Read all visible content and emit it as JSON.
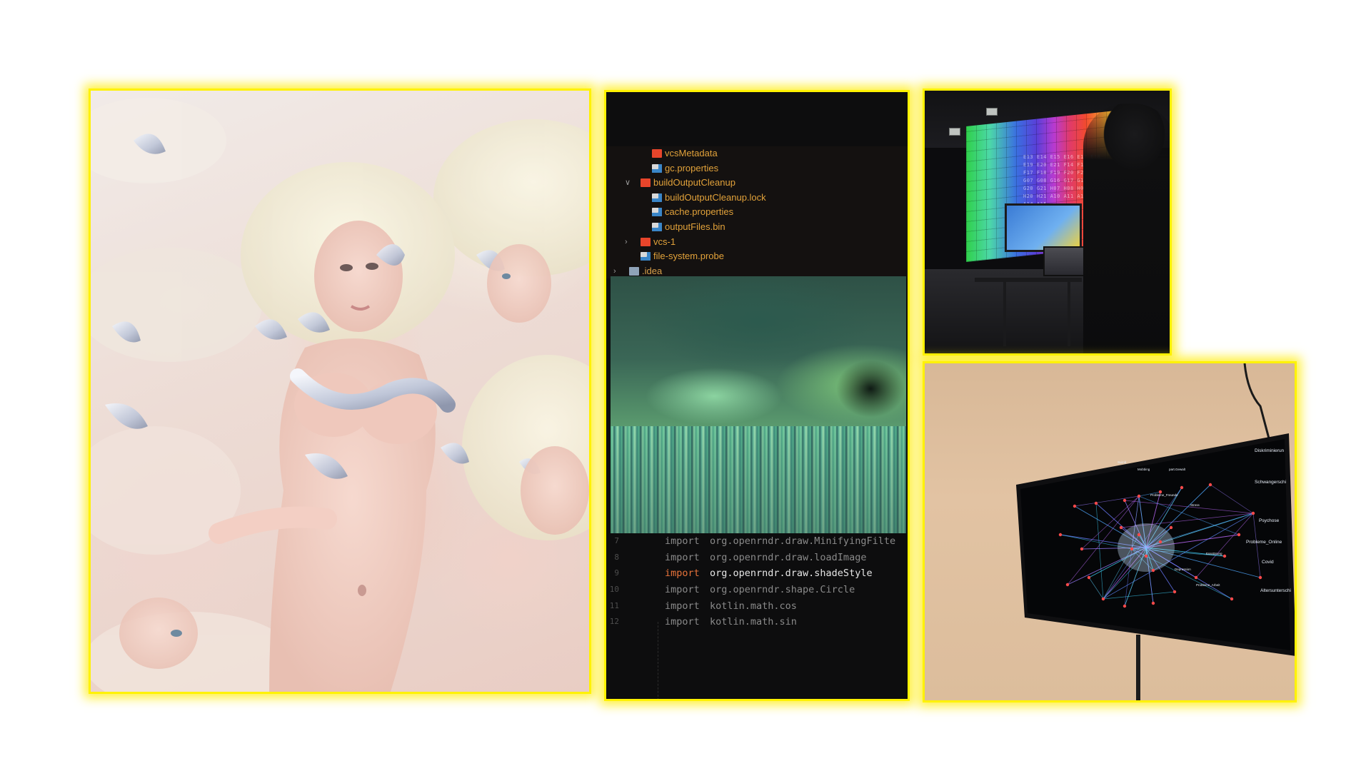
{
  "file_tree": [
    {
      "indent": 1,
      "chevron": "",
      "icon": "folder-icon",
      "label": "vcsMetadata"
    },
    {
      "indent": 1,
      "chevron": "",
      "icon": "file-icon",
      "label": "gc.properties"
    },
    {
      "indent": 0,
      "chevron": "∨",
      "icon": "folder-icon",
      "label": "buildOutputCleanup"
    },
    {
      "indent": 1,
      "chevron": "",
      "icon": "file-icon",
      "label": "buildOutputCleanup.lock"
    },
    {
      "indent": 1,
      "chevron": "",
      "icon": "file-icon",
      "label": "cache.properties"
    },
    {
      "indent": 1,
      "chevron": "",
      "icon": "file-icon",
      "label": "outputFiles.bin"
    },
    {
      "indent": 0,
      "chevron": "›",
      "icon": "folder-icon",
      "label": "vcs-1"
    },
    {
      "indent": 0,
      "chevron": "",
      "icon": "file-icon",
      "label": "file-system.probe"
    },
    {
      "indent": -1,
      "chevron": "›",
      "icon": "folder-plain-icon",
      "label": ".idea"
    }
  ],
  "code_lines": [
    {
      "num": "7",
      "kw": "import",
      "text": "org.openrndr.draw.MinifyingFilte",
      "active": false
    },
    {
      "num": "8",
      "kw": "import",
      "text": "org.openrndr.draw.loadImage",
      "active": false
    },
    {
      "num": "9",
      "kw": "import",
      "text": "org.openrndr.draw.shadeStyle",
      "active": true
    },
    {
      "num": "10",
      "kw": "import",
      "text": "org.openrndr.shape.Circle",
      "active": false
    },
    {
      "num": "11",
      "kw": "import",
      "text": "kotlin.math.cos",
      "active": false
    },
    {
      "num": "12",
      "kw": "import",
      "text": "kotlin.math.sin",
      "active": false
    }
  ],
  "wall_grid_text": "E13 E14 E15 E16 E17 E18 E19 E20 E21 F14 F15 F16 F17 F18 F19 F20 F21 G06 G07 G08 G16 G17 G18 G19 G20 G21 H07 H08 H09 H10 H20 H21 A10 A11 A12 A13 A14 A15",
  "network_labels": {
    "top_right": "Diskriminierun",
    "right_1": "Schwangerschi",
    "right_2": "Psychose",
    "right_3": "Probleme_Online",
    "right_4": "Covid",
    "right_5": "Altersunterschi",
    "center_1": "part.Gewalt",
    "center_2": "Mobbing",
    "center_3": "Probleme_Freunde",
    "center_4": "Stress",
    "center_5": "Suizid",
    "center_6": "Probleme_Arbeit",
    "center_7": "Depression",
    "center_8": "Essstörung"
  },
  "colors": {
    "frame": "#fff200",
    "code_keyword_active": "#e8733a",
    "code_dim": "#8a8a8a",
    "tree_label": "#e2a23a"
  }
}
